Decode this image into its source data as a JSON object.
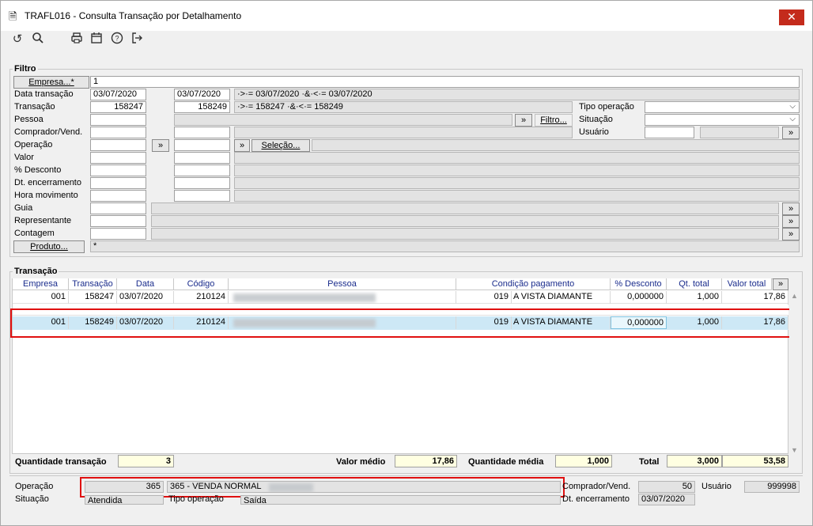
{
  "window": {
    "title": "TRAFL016 - Consulta Transação por Detalhamento",
    "close_glyph": "✕"
  },
  "toolbar": {
    "icons": [
      "refresh-icon",
      "search-icon",
      "print-icon",
      "calendar-icon",
      "help-icon",
      "exit-icon"
    ]
  },
  "filtro": {
    "title": "Filtro",
    "empresa_btn": "Empresa...*",
    "empresa_value": "1",
    "labels": [
      "Data transação",
      "Transação",
      "Pessoa",
      "Comprador/Vend.",
      "Operação",
      "Valor",
      "% Desconto",
      "Dt. encerramento",
      "Hora movimento",
      "Guia",
      "Representante",
      "Contagem"
    ],
    "data_from": "03/07/2020",
    "data_to": "03/07/2020",
    "data_expr": "·>·= 03/07/2020 ·&·<·= 03/07/2020",
    "trans_from": "158247",
    "trans_to": "158249",
    "trans_expr": "·>·= 158247 ·&·<·= 158249",
    "arrow": "»",
    "filtro_btn": "Filtro...",
    "selecao_btn": "Seleção...",
    "produto_btn": "Produto...",
    "produto_value": "*",
    "tipo_operacao_label": "Tipo operação",
    "situacao_label": "Situação",
    "usuario_label": "Usuário",
    "chev": "⌵"
  },
  "transacao": {
    "title": "Transação",
    "columns": [
      "Empresa",
      "Transação",
      "Data",
      "Código",
      "Pessoa",
      "Condição pagamento",
      "% Desconto",
      "Qt. total",
      "Valor total"
    ],
    "rows": [
      {
        "empresa": "001",
        "transacao": "158247",
        "data": "03/07/2020",
        "codigo": "210124",
        "cond_cod": "019",
        "cond": "A VISTA DIAMANTE",
        "desc": "0,000000",
        "qt": "1,000",
        "valor": "17,86"
      },
      {
        "empresa": "001",
        "transacao": "158249",
        "data": "03/07/2020",
        "codigo": "210124",
        "cond_cod": "019",
        "cond": "A VISTA DIAMANTE",
        "desc": "0,000000",
        "qt": "1,000",
        "valor": "17,86"
      }
    ]
  },
  "totals": {
    "qtd_trans_label": "Quantidade transação",
    "qtd_trans": "3",
    "valor_medio_label": "Valor médio",
    "valor_medio": "17,86",
    "qtd_media_label": "Quantidade média",
    "qtd_media": "1,000",
    "total_label": "Total",
    "total_qt": "3,000",
    "total_valor": "53,58"
  },
  "detail": {
    "operacao_label": "Operação",
    "operacao_cod": "365",
    "operacao_desc": "365 - VENDA NORMAL",
    "situacao_label": "Situação",
    "situacao": "Atendida",
    "tipo_operacao_label": "Tipo operação",
    "tipo_operacao": "Saída",
    "comprador_label": "Comprador/Vend.",
    "comprador": "50",
    "usuario_label": "Usuário",
    "usuario": "999998",
    "dt_enc_label": "Dt. encerramento",
    "dt_enc": "03/07/2020"
  },
  "colors": {
    "highlight": "#e01010",
    "selected_row": "#cde8f6",
    "header_text": "#1a2c8c"
  }
}
